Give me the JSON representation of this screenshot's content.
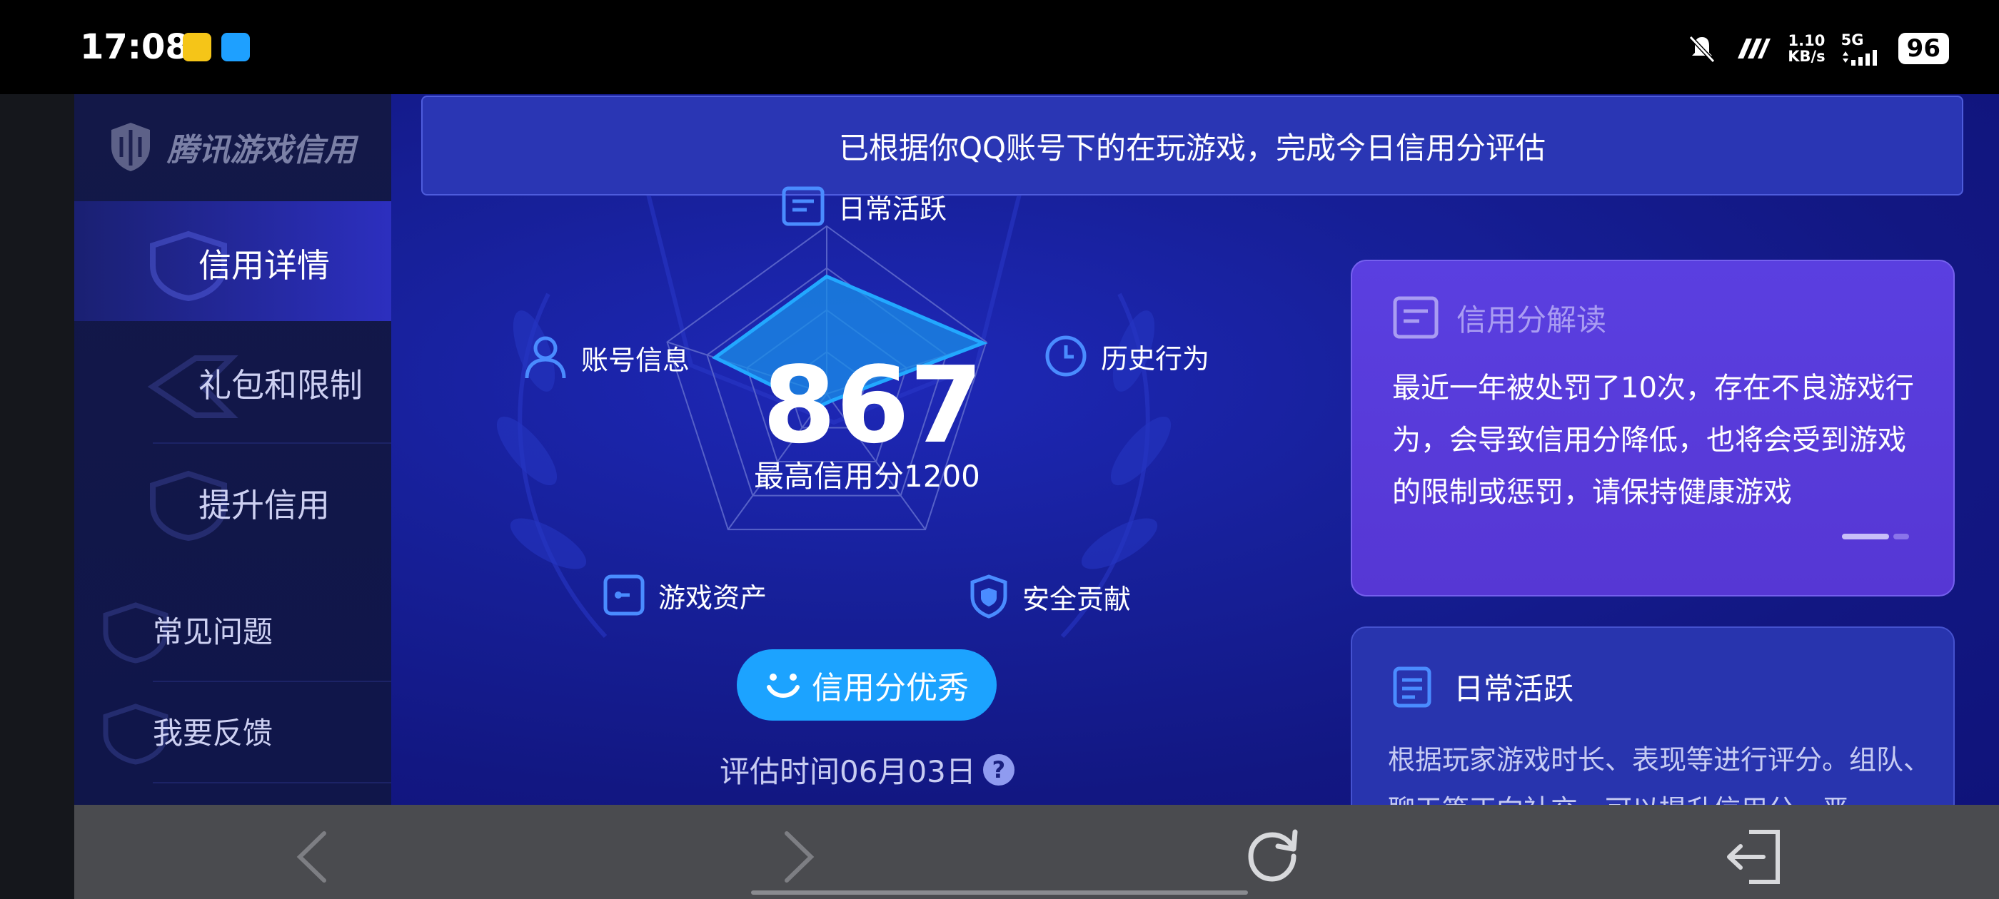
{
  "status_bar": {
    "time": "17:08",
    "speed_value": "1.10",
    "speed_unit": "KB/s",
    "network": "5G",
    "battery": "96"
  },
  "sidebar": {
    "brand": "腾讯游戏信用",
    "items": [
      {
        "label": "信用详情",
        "active": true
      },
      {
        "label": "礼包和限制",
        "active": false
      },
      {
        "label": "提升信用",
        "active": false
      },
      {
        "label": "常见问题",
        "active": false
      },
      {
        "label": "我要反馈",
        "active": false
      }
    ]
  },
  "banner": {
    "text": "已根据你QQ账号下的在玩游戏，完成今日信用分评估"
  },
  "radar": {
    "labels": {
      "daily": "日常活跃",
      "history": "历史行为",
      "security": "安全贡献",
      "assets": "游戏资产",
      "account": "账号信息"
    },
    "score": "867",
    "max_text": "最高信用分1200",
    "levels": {
      "daily": 0.7,
      "history": 0.98,
      "security": 0.05,
      "assets": 0.1,
      "account": 0.7
    }
  },
  "status_pill": {
    "label": "信用分优秀"
  },
  "eval_time": {
    "label": "评估时间06月03日",
    "help": "?"
  },
  "card_interpret": {
    "title": "信用分解读",
    "body": "最近一年被处罚了10次，存在不良游戏行为，会导致信用分降低，也将会受到游戏的限制或惩罚，请保持健康游戏"
  },
  "card_daily": {
    "title": "日常活跃",
    "body": "根据玩家游戏时长、表现等进行评分。组队、聊天等正向社交，可以提升信用分，严"
  },
  "colors": {
    "accent": "#1ca3ff",
    "card_purple": "#5a3fe0",
    "radar_fill": "#1a8fe8"
  },
  "icons": {
    "back": "chevron-left-icon",
    "forward": "chevron-right-icon",
    "refresh": "refresh-icon",
    "exit": "exit-icon"
  }
}
